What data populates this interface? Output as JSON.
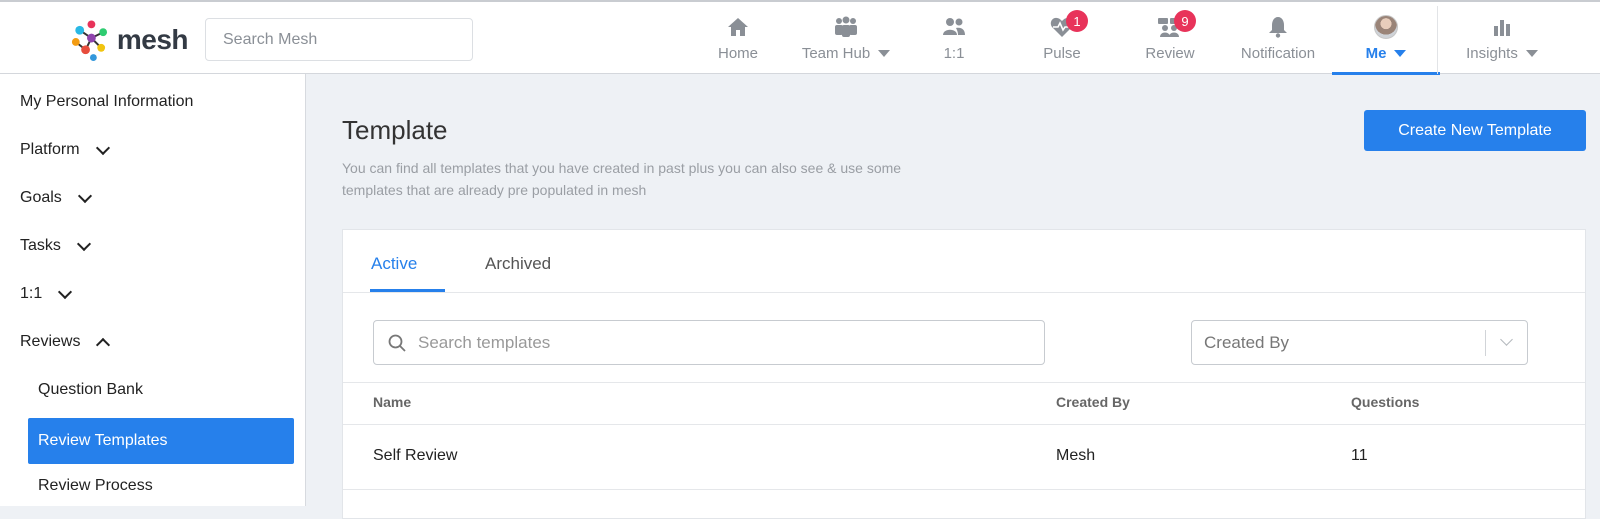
{
  "app": {
    "brand": "mesh",
    "search_placeholder": "Search Mesh",
    "accent": "#2680eb",
    "badge_color": "#e8335a"
  },
  "nav": {
    "home": {
      "label": "Home",
      "icon": "home-icon"
    },
    "team_hub": {
      "label": "Team Hub",
      "icon": "team-icon"
    },
    "one_on_one": {
      "label": "1:1",
      "icon": "people-icon"
    },
    "pulse": {
      "label": "Pulse",
      "icon": "heartbeat-icon",
      "badge": "1"
    },
    "review": {
      "label": "Review",
      "icon": "review-icon",
      "badge": "9"
    },
    "notification": {
      "label": "Notification",
      "icon": "bell-icon"
    },
    "me": {
      "label": "Me",
      "icon": "avatar"
    },
    "insights": {
      "label": "Insights",
      "icon": "bar-chart-icon"
    }
  },
  "sidebar": {
    "personal_info": "My Personal Information",
    "platform": "Platform",
    "goals": "Goals",
    "tasks": "Tasks",
    "one_on_one": "1:1",
    "reviews": "Reviews",
    "question_bank": "Question Bank",
    "review_templates": "Review Templates",
    "review_process": "Review Process"
  },
  "page": {
    "title": "Template",
    "description": "You can find all templates that you have created in past plus you can also see & use some templates that are already pre populated in mesh",
    "create_button": "Create New Template"
  },
  "tabs": {
    "active": "Active",
    "archived": "Archived"
  },
  "filters": {
    "search_placeholder": "Search templates",
    "created_by_placeholder": "Created By"
  },
  "table": {
    "headers": {
      "name": "Name",
      "created_by": "Created By",
      "questions": "Questions"
    },
    "rows": [
      {
        "name": "Self Review",
        "created_by": "Mesh",
        "questions": "11"
      }
    ]
  }
}
